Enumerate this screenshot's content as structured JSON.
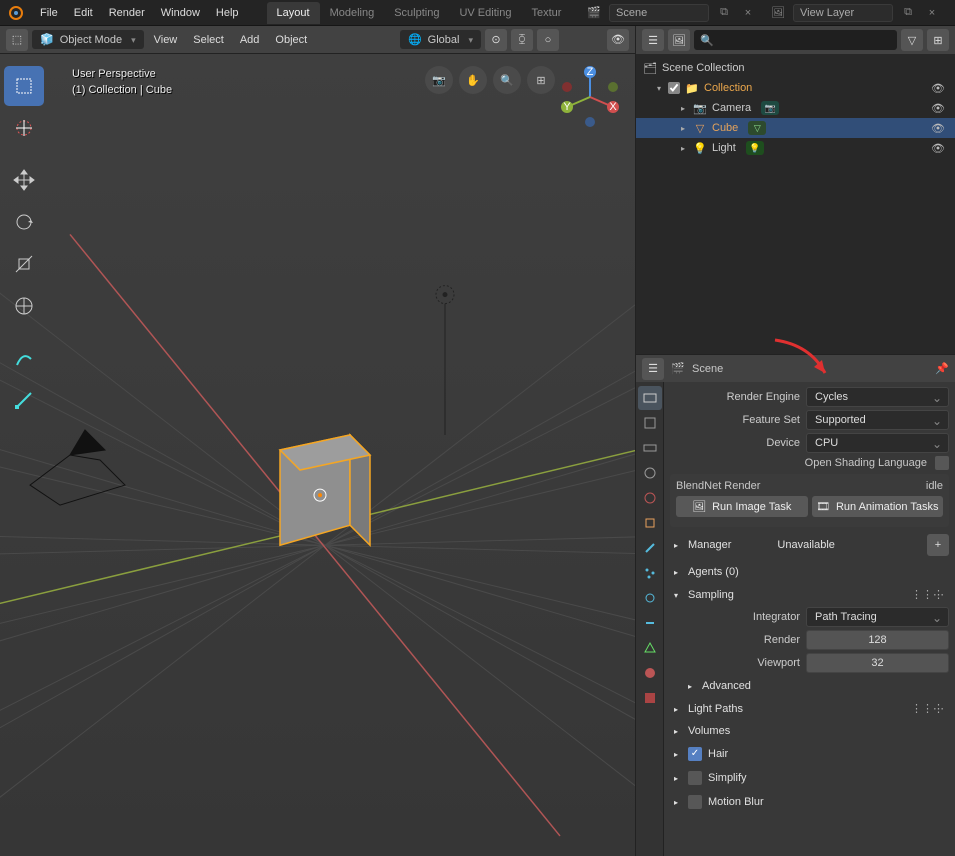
{
  "topmenu": {
    "file": "File",
    "edit": "Edit",
    "render": "Render",
    "window": "Window",
    "help": "Help"
  },
  "workspaces": {
    "layout": "Layout",
    "modeling": "Modeling",
    "sculpting": "Sculpting",
    "uv": "UV Editing",
    "texture": "Textur"
  },
  "header_scene": {
    "scene": "Scene",
    "viewlayer": "View Layer"
  },
  "view3d": {
    "mode": "Object Mode",
    "view": "View",
    "select": "Select",
    "add": "Add",
    "object": "Object",
    "orientation": "Global",
    "info_line1": "User Perspective",
    "info_line2": "(1) Collection | Cube"
  },
  "outliner": {
    "root": "Scene Collection",
    "collection": "Collection",
    "camera": "Camera",
    "cube": "Cube",
    "light": "Light"
  },
  "props": {
    "breadcrumb": "Scene",
    "render_engine_label": "Render Engine",
    "render_engine_val": "Cycles",
    "feature_set_label": "Feature Set",
    "feature_set_val": "Supported",
    "device_label": "Device",
    "device_val": "CPU",
    "osl_label": "Open Shading Language",
    "blendnet_title": "BlendNet Render",
    "blendnet_status": "idle",
    "run_image": "Run Image Task",
    "run_anim": "Run Animation Tasks",
    "manager": "Manager",
    "manager_status": "Unavailable",
    "agents": "Agents (0)",
    "sampling": "Sampling",
    "integrator_label": "Integrator",
    "integrator_val": "Path Tracing",
    "render_label": "Render",
    "render_val": "128",
    "viewport_label": "Viewport",
    "viewport_val": "32",
    "advanced": "Advanced",
    "light_paths": "Light Paths",
    "volumes": "Volumes",
    "hair": "Hair",
    "simplify": "Simplify",
    "motion_blur": "Motion Blur"
  }
}
